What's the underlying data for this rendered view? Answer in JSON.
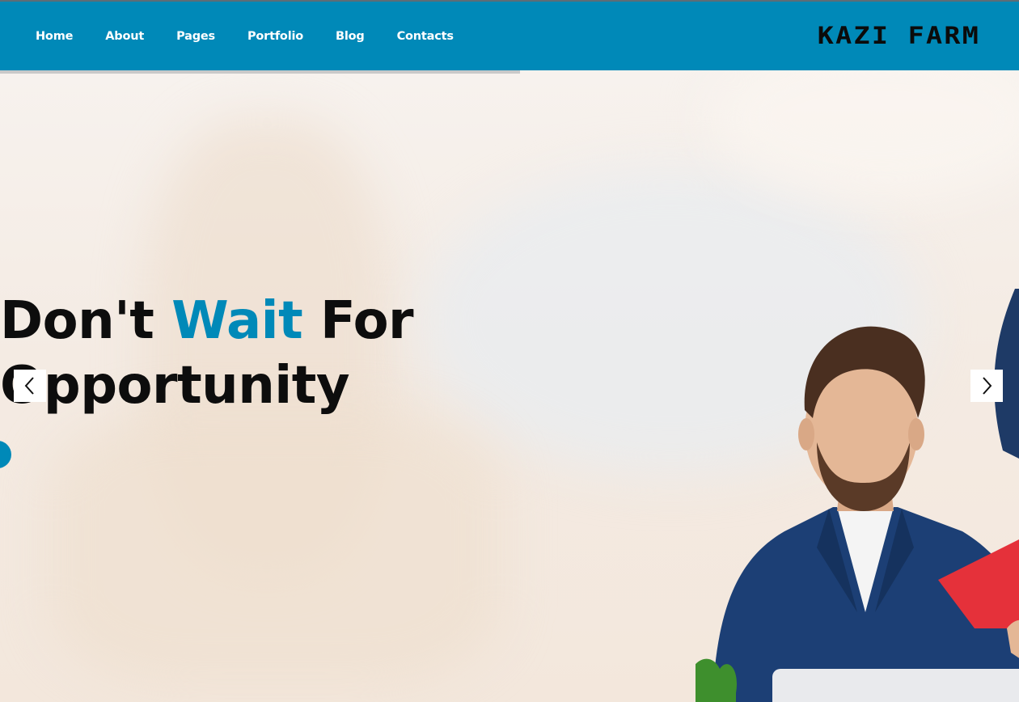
{
  "nav": {
    "items": [
      {
        "label": "Home"
      },
      {
        "label": "About"
      },
      {
        "label": "Pages"
      },
      {
        "label": "Portfolio"
      },
      {
        "label": "Blog"
      },
      {
        "label": "Contacts"
      }
    ]
  },
  "logo": {
    "text": "Kazi Farm"
  },
  "slider": {
    "progress": 0.51,
    "headline": {
      "line1_part1": "Don't",
      "line1_accent": "Wait",
      "line1_part2": "For",
      "line2": "Opportunity"
    },
    "prev_icon": "chevron-left-icon",
    "next_icon": "chevron-right-icon"
  },
  "colors": {
    "brand": "#0089b8",
    "header_bg": "#0089b8",
    "text_dark": "#0d0d0d"
  }
}
